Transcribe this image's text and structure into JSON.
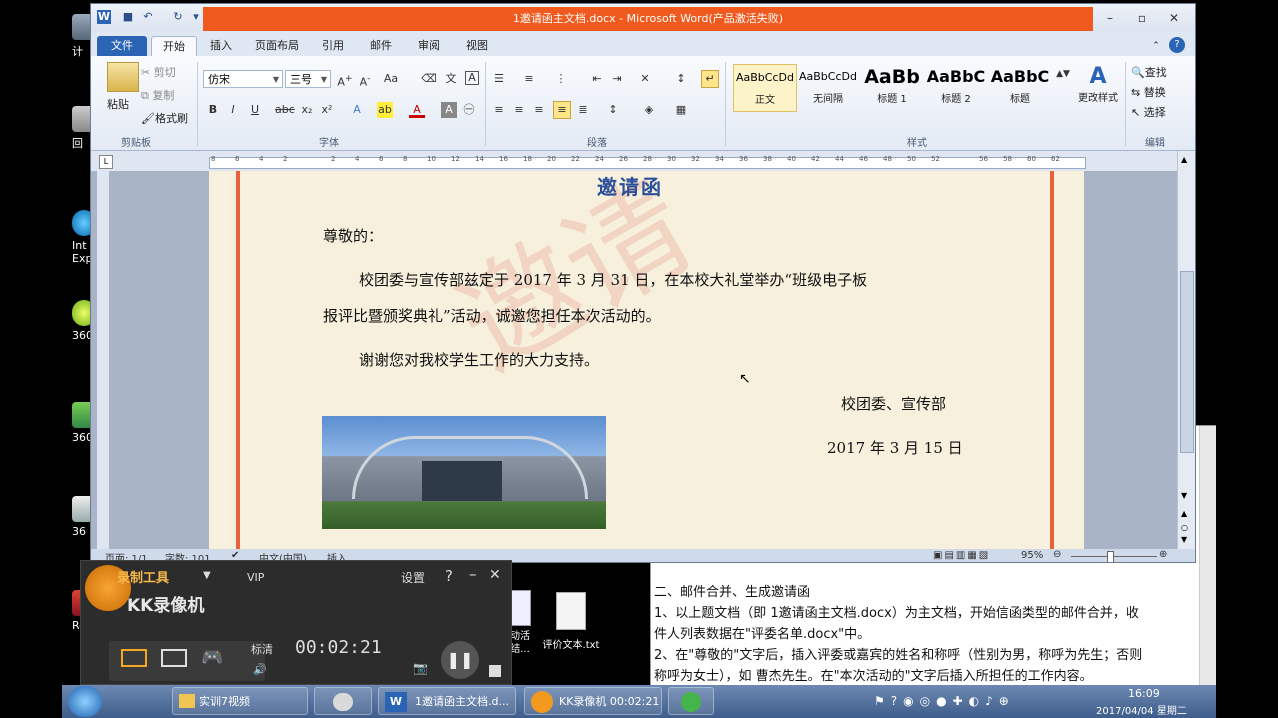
{
  "desktop": {
    "icons": [
      {
        "label": "计",
        "icon": "computer-icon"
      },
      {
        "label": "回",
        "icon": "recycle-bin-icon"
      },
      {
        "label": "Int\nExp",
        "icon": "ie-icon"
      },
      {
        "label": "360",
        "icon": "360-icon"
      },
      {
        "label": "360",
        "icon": "360-safe-icon"
      },
      {
        "label": "36",
        "icon": "360-guard-icon"
      },
      {
        "label": "Re",
        "icon": "app-icon"
      }
    ]
  },
  "word": {
    "title": "1邀请函主文档.docx  -  Microsoft Word(产品激活失败)",
    "tabs": [
      "文件",
      "开始",
      "插入",
      "页面布局",
      "引用",
      "邮件",
      "审阅",
      "视图"
    ],
    "active_tab": "开始",
    "clipboard": {
      "paste": "粘贴",
      "cut": "剪切",
      "copy": "复制",
      "format_painter": "格式刷",
      "group": "剪贴板"
    },
    "font": {
      "family": "仿宋",
      "size": "三号",
      "group": "字体"
    },
    "paragraph": {
      "group": "段落"
    },
    "styles": {
      "group": "样式",
      "items": [
        {
          "preview": "AaBbCcDd",
          "label": "正文"
        },
        {
          "preview": "AaBbCcDd",
          "label": "无间隔"
        },
        {
          "preview": "AaBb",
          "label": "标题 1"
        },
        {
          "preview": "AaBbC",
          "label": "标题 2"
        },
        {
          "preview": "AaBbC",
          "label": "标题"
        }
      ],
      "change": "更改样式"
    },
    "editing": {
      "find": "查找",
      "replace": "替换",
      "select": "选择",
      "group": "编辑"
    },
    "ruler_numbers": [
      "8",
      "6",
      "4",
      "2",
      "",
      "2",
      "4",
      "6",
      "8",
      "10",
      "12",
      "14",
      "16",
      "18",
      "20",
      "22",
      "24",
      "26",
      "28",
      "30",
      "32",
      "34",
      "36",
      "38",
      "40",
      "42",
      "44",
      "46",
      "48",
      "50",
      "52",
      "",
      "56",
      "58",
      "60",
      "62"
    ],
    "document": {
      "heading": "邀请函",
      "greeting": "尊敬的：",
      "para1_line1": "校团委与宣传部兹定于 2017 年 3 月 31 日，在本校大礼堂举办“班级电子板",
      "para1_line2": "报评比暨颁奖典礼”活动，诚邀您担任本次活动的。",
      "para2": "谢谢您对我校学生工作的大力支持。",
      "sign": "校团委、宣传部",
      "date": "2017 年 3 月 15 日"
    },
    "status": {
      "page": "页面: 1/1",
      "words": "字数: 101",
      "lang": "中文(中国)",
      "mode": "插入",
      "zoom": "95%"
    }
  },
  "overlay": {
    "lines": [
      "二、邮件合并、生成邀请函",
      "1、以上题文档（即 1邀请函主文档.docx）为主文档，开始信函类型的邮件合并，收",
      "件人列表数据在\"评委名单.docx\"中。",
      "2、在\"尊敬的\"文字后，插入评委或嘉宾的姓名和称呼（性别为男，称呼为先生；否则",
      "称呼为女士），如  曹杰先生。在\"本次活动的\"文字后插入所担任的工作内容。"
    ]
  },
  "explorer": {
    "files": [
      {
        "label": "动活\n结...",
        "icon": "doc-file-icon"
      },
      {
        "label": "评价文本.txt",
        "icon": "txt-file-icon"
      }
    ]
  },
  "recorder": {
    "brand_top": "录制工具",
    "brand_main": "KK录像机",
    "vip": "VIP",
    "settings": "设置",
    "help": "?",
    "quality": "标清",
    "timer": "00:02:21"
  },
  "taskbar": {
    "items": [
      {
        "label": "实训7视频",
        "icon": "folder-icon"
      },
      {
        "label": "",
        "icon": "app-icon"
      },
      {
        "label": "1邀请函主文档.d...",
        "icon": "word-icon"
      },
      {
        "label": "KK录像机 00:02:21",
        "icon": "kk-icon"
      },
      {
        "label": "",
        "icon": "refresh-icon"
      }
    ],
    "time": "16:09",
    "date": "2017/04/04 星期二"
  }
}
